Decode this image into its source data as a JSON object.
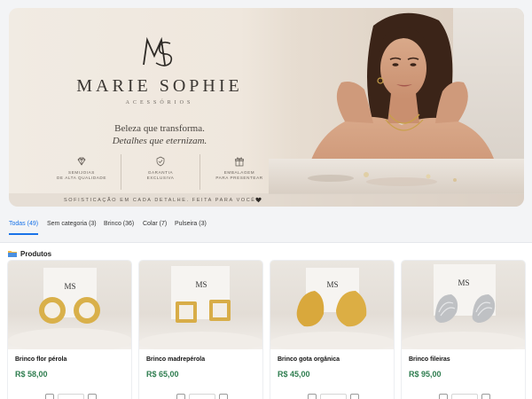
{
  "banner": {
    "brand_name": "MARIE SOPHIE",
    "brand_sub": "ACESSÓRIOS",
    "tagline_line1": "Beleza que transforma.",
    "tagline_line2": "Detalhes que eternizam.",
    "features": [
      {
        "icon": "diamond-icon",
        "label_line1": "SEMIJOIAS",
        "label_line2": "DE ALTA QUALIDADE"
      },
      {
        "icon": "shield-icon",
        "label_line1": "GARANTIA",
        "label_line2": "EXCLUSIVA"
      },
      {
        "icon": "gift-icon",
        "label_line1": "EMBALAGEM",
        "label_line2": "PARA PRESENTEAR"
      }
    ],
    "footer_text": "SOFISTICAÇÃO EM CADA DETALHE. FEITA PARA VOCÊ."
  },
  "tabs": [
    {
      "label": "Todas (49)",
      "active": true
    },
    {
      "label": "Sem categoria (3)",
      "active": false
    },
    {
      "label": "Brinco (36)",
      "active": false
    },
    {
      "label": "Colar (7)",
      "active": false
    },
    {
      "label": "Pulseira (3)",
      "active": false
    }
  ],
  "products_section": {
    "title": "Produtos",
    "icon": "folder-icon"
  },
  "products": [
    {
      "name": "Brinco flor pérola",
      "price": "R$ 58,00"
    },
    {
      "name": "Brinco madrepérola",
      "price": "R$ 65,00"
    },
    {
      "name": "Brinco gota orgânica",
      "price": "R$ 45,00"
    },
    {
      "name": "Brinco fileiras",
      "price": "R$ 95,00"
    }
  ],
  "colors": {
    "accent": "#1a73e8",
    "price": "#2e7d4f"
  }
}
